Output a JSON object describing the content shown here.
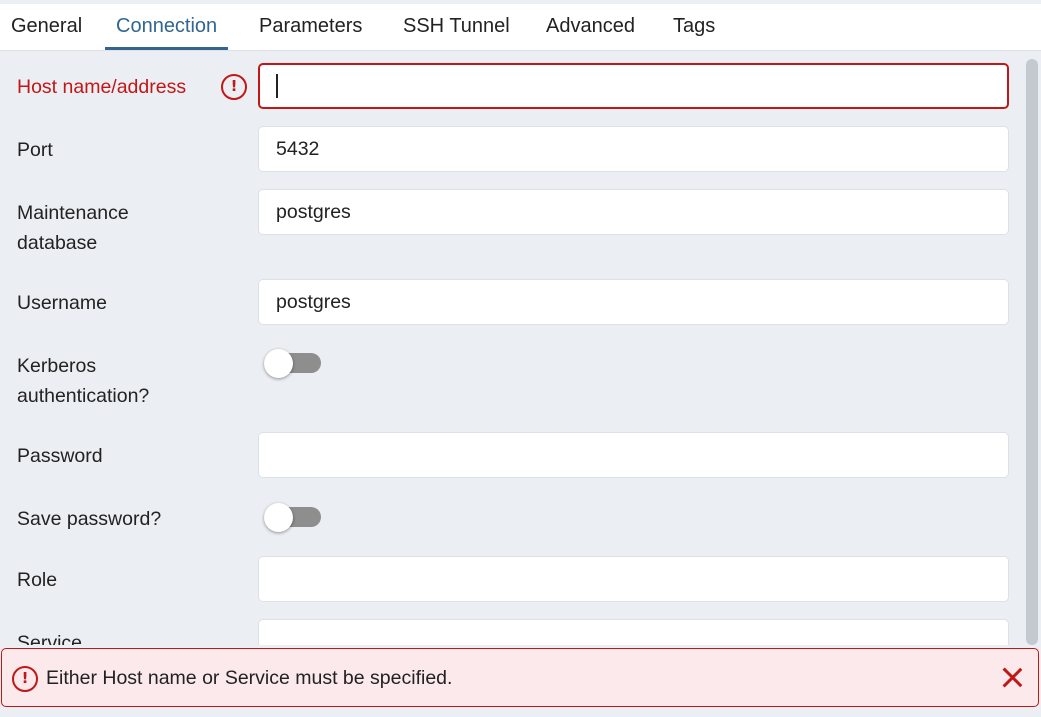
{
  "tabs": [
    {
      "label": "General"
    },
    {
      "label": "Connection"
    },
    {
      "label": "Parameters"
    },
    {
      "label": "SSH Tunnel"
    },
    {
      "label": "Advanced"
    },
    {
      "label": "Tags"
    }
  ],
  "active_tab": "Connection",
  "form": {
    "host": {
      "label": "Host name/address",
      "value": "",
      "error": true
    },
    "port": {
      "label": "Port",
      "value": "5432"
    },
    "maintenance_db": {
      "label_line1": "Maintenance",
      "label_line2": "database",
      "value": "postgres"
    },
    "username": {
      "label": "Username",
      "value": "postgres"
    },
    "kerberos": {
      "label_line1": "Kerberos",
      "label_line2": "authentication?",
      "enabled": false
    },
    "password": {
      "label": "Password",
      "value": ""
    },
    "save_password": {
      "label": "Save password?",
      "enabled": false
    },
    "role": {
      "label": "Role",
      "value": ""
    },
    "service": {
      "label": "Service",
      "value": ""
    }
  },
  "alert": {
    "message": "Either Host name or Service must be specified."
  },
  "colors": {
    "accent": "#326690",
    "error": "#c21717",
    "error_bg": "#fbe9eb",
    "panel_bg": "#ebeef3"
  },
  "icons": {
    "error": "exclamation-circle-icon",
    "close": "close-x-icon"
  }
}
